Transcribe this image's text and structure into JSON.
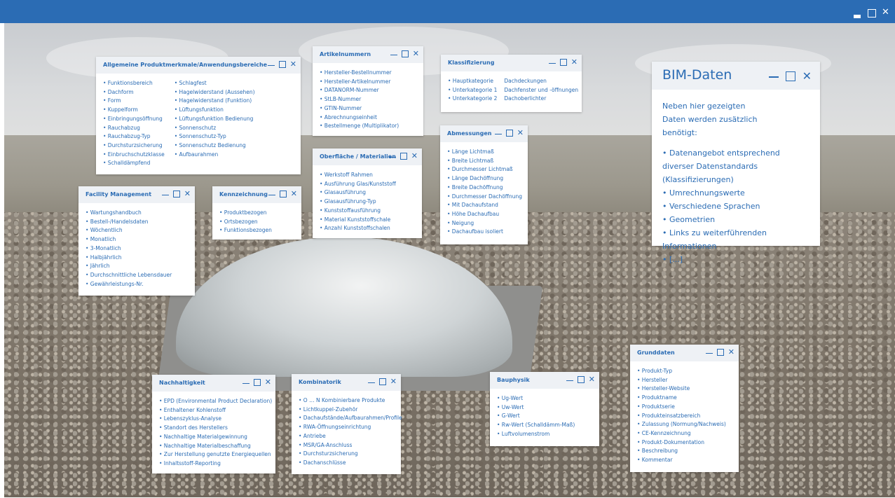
{
  "windows": {
    "allgemein": {
      "title": "Allgemeine Produktmerkmale/Anwendungsbereiche",
      "col1": [
        "• Funktionsbereich",
        "• Dachform",
        "• Form",
        "• Kuppelform",
        "• Einbringungsöffnung",
        "• Rauchabzug",
        "• Rauchabzug-Typ",
        "• Durchsturzsicherung",
        "• Einbruchschutzklasse",
        "• Schalldämpfend"
      ],
      "col2": [
        "• Schlagfest",
        "• Hagelwiderstand (Aussehen)",
        "• Hagelwiderstand (Funktion)",
        "• Lüftungsfunktion",
        "• Lüftungsfunktion Bedienung",
        "• Sonnenschutz",
        "• Sonnenschutz-Typ",
        "• Sonnenschutz Bedienung",
        "• Aufbaurahmen"
      ]
    },
    "artikel": {
      "title": "Artikelnummern",
      "items": [
        "• Hersteller-Bestellnummer",
        "• Hersteller-Artikelnummer",
        "• DATANORM-Nummer",
        "• StLB-Nummer",
        "• GTIN-Nummer",
        "• Abrechnungseinheit",
        "• Bestellmenge (Multiplikator)"
      ]
    },
    "klassifizierung": {
      "title": "Klassifizierung",
      "col1": [
        "• Hauptkategorie",
        "• Unterkategorie 1",
        "• Unterkategorie 2"
      ],
      "col2": [
        "Dachdeckungen",
        "Dachfenster und -öffnungen",
        "Dachoberlichter"
      ]
    },
    "facility": {
      "title": "Facility Management",
      "items": [
        "• Wartungshandbuch",
        "• Bestell-/Handelsdaten",
        "• Wöchentlich",
        "• Monatlich",
        "• 3-Monatlich",
        "• Halbjährlich",
        "• Jährlich",
        "• Durchschnittliche Lebensdauer",
        "• Gewährleistungs-Nr."
      ]
    },
    "kennzeichnung": {
      "title": "Kennzeichnung",
      "items": [
        "• Produktbezogen",
        "• Ortsbezogen",
        "• Funktionsbezogen"
      ]
    },
    "oberflaeche": {
      "title": "Oberfläche / Materialien",
      "items": [
        "• Werkstoff Rahmen",
        "• Ausführung Glas/Kunststoff",
        "• Glasausführung",
        "• Glasausführung-Typ",
        "• Kunststoffausführung",
        "• Material Kunststoffschale",
        "• Anzahl Kunststoffschalen"
      ]
    },
    "abmessungen": {
      "title": "Abmessungen",
      "items": [
        "• Länge Lichtmaß",
        "• Breite Lichtmaß",
        "• Durchmesser Lichtmaß",
        "• Länge Dachöffnung",
        "• Breite Dachöffnung",
        "• Durchmesser Dachöffnung",
        "• Mit Dachaufstand",
        "• Höhe Dachaufbau",
        "• Neigung",
        "• Dachaufbau isoliert"
      ]
    },
    "bim": {
      "title": "BIM-Daten",
      "intro": "Neben hier gezeigten Daten werden zusätzlich benötigt:",
      "items": [
        "• Datenangebot entsprechend diverser Datenstandards (Klassifizierungen)",
        "• Umrechnungswerte",
        "• Verschiedene Sprachen",
        "• Geometrien",
        "• Links zu weiterführenden Informationen",
        "• [...]"
      ]
    },
    "grunddaten": {
      "title": "Grunddaten",
      "items": [
        "• Produkt-Typ",
        "• Hersteller",
        "• Hersteller-Website",
        "• Produktname",
        "• Produktserie",
        "• Produkteinsatzbereich",
        "• Zulassung (Normung/Nachweis)",
        "• CE-Kennzeichnung",
        "• Produkt-Dokumentation",
        "• Beschreibung",
        "• Kommentar"
      ]
    },
    "nachhaltigkeit": {
      "title": "Nachhaltigkeit",
      "items": [
        "• EPD (Environmental Product Declaration)",
        "• Enthaltener Kohlenstoff",
        "• Lebenszyklus-Analyse",
        "• Standort des Herstellers",
        "• Nachhaltige Materialgewinnung",
        "• Nachhaltige Materialbeschaffung",
        "• Zur Herstellung genutzte Energiequellen",
        "• Inhaltsstoff-Reporting"
      ]
    },
    "kombinatorik": {
      "title": "Kombinatorik",
      "items": [
        "• O … N Kombinierbare Produkte",
        "• Lichtkuppel-Zubehör",
        "• Dachaufstände/Aufbaurahmen/Profile",
        "• RWA-Öffnungseinrichtung",
        "• Antriebe",
        "• MSR/GA-Anschluss",
        "• Durchsturzsicherung",
        "• Dachanschlüsse"
      ]
    },
    "bauphysik": {
      "title": "Bauphysik",
      "items": [
        "• Ug-Wert",
        "• Uw-Wert",
        "• G-Wert",
        "• Rw-Wert (Schalldämm-Maß)",
        "• Luftvolumenstrom"
      ]
    }
  },
  "controls": {
    "minimize_icon": "minimize-icon",
    "maximize_icon": "maximize-icon",
    "close_icon": "close-icon",
    "close_glyph": "✕"
  },
  "colors": {
    "accent": "#2b6cb4",
    "header_bg": "#eef1f5",
    "titlebar": "#2b6cb4"
  }
}
